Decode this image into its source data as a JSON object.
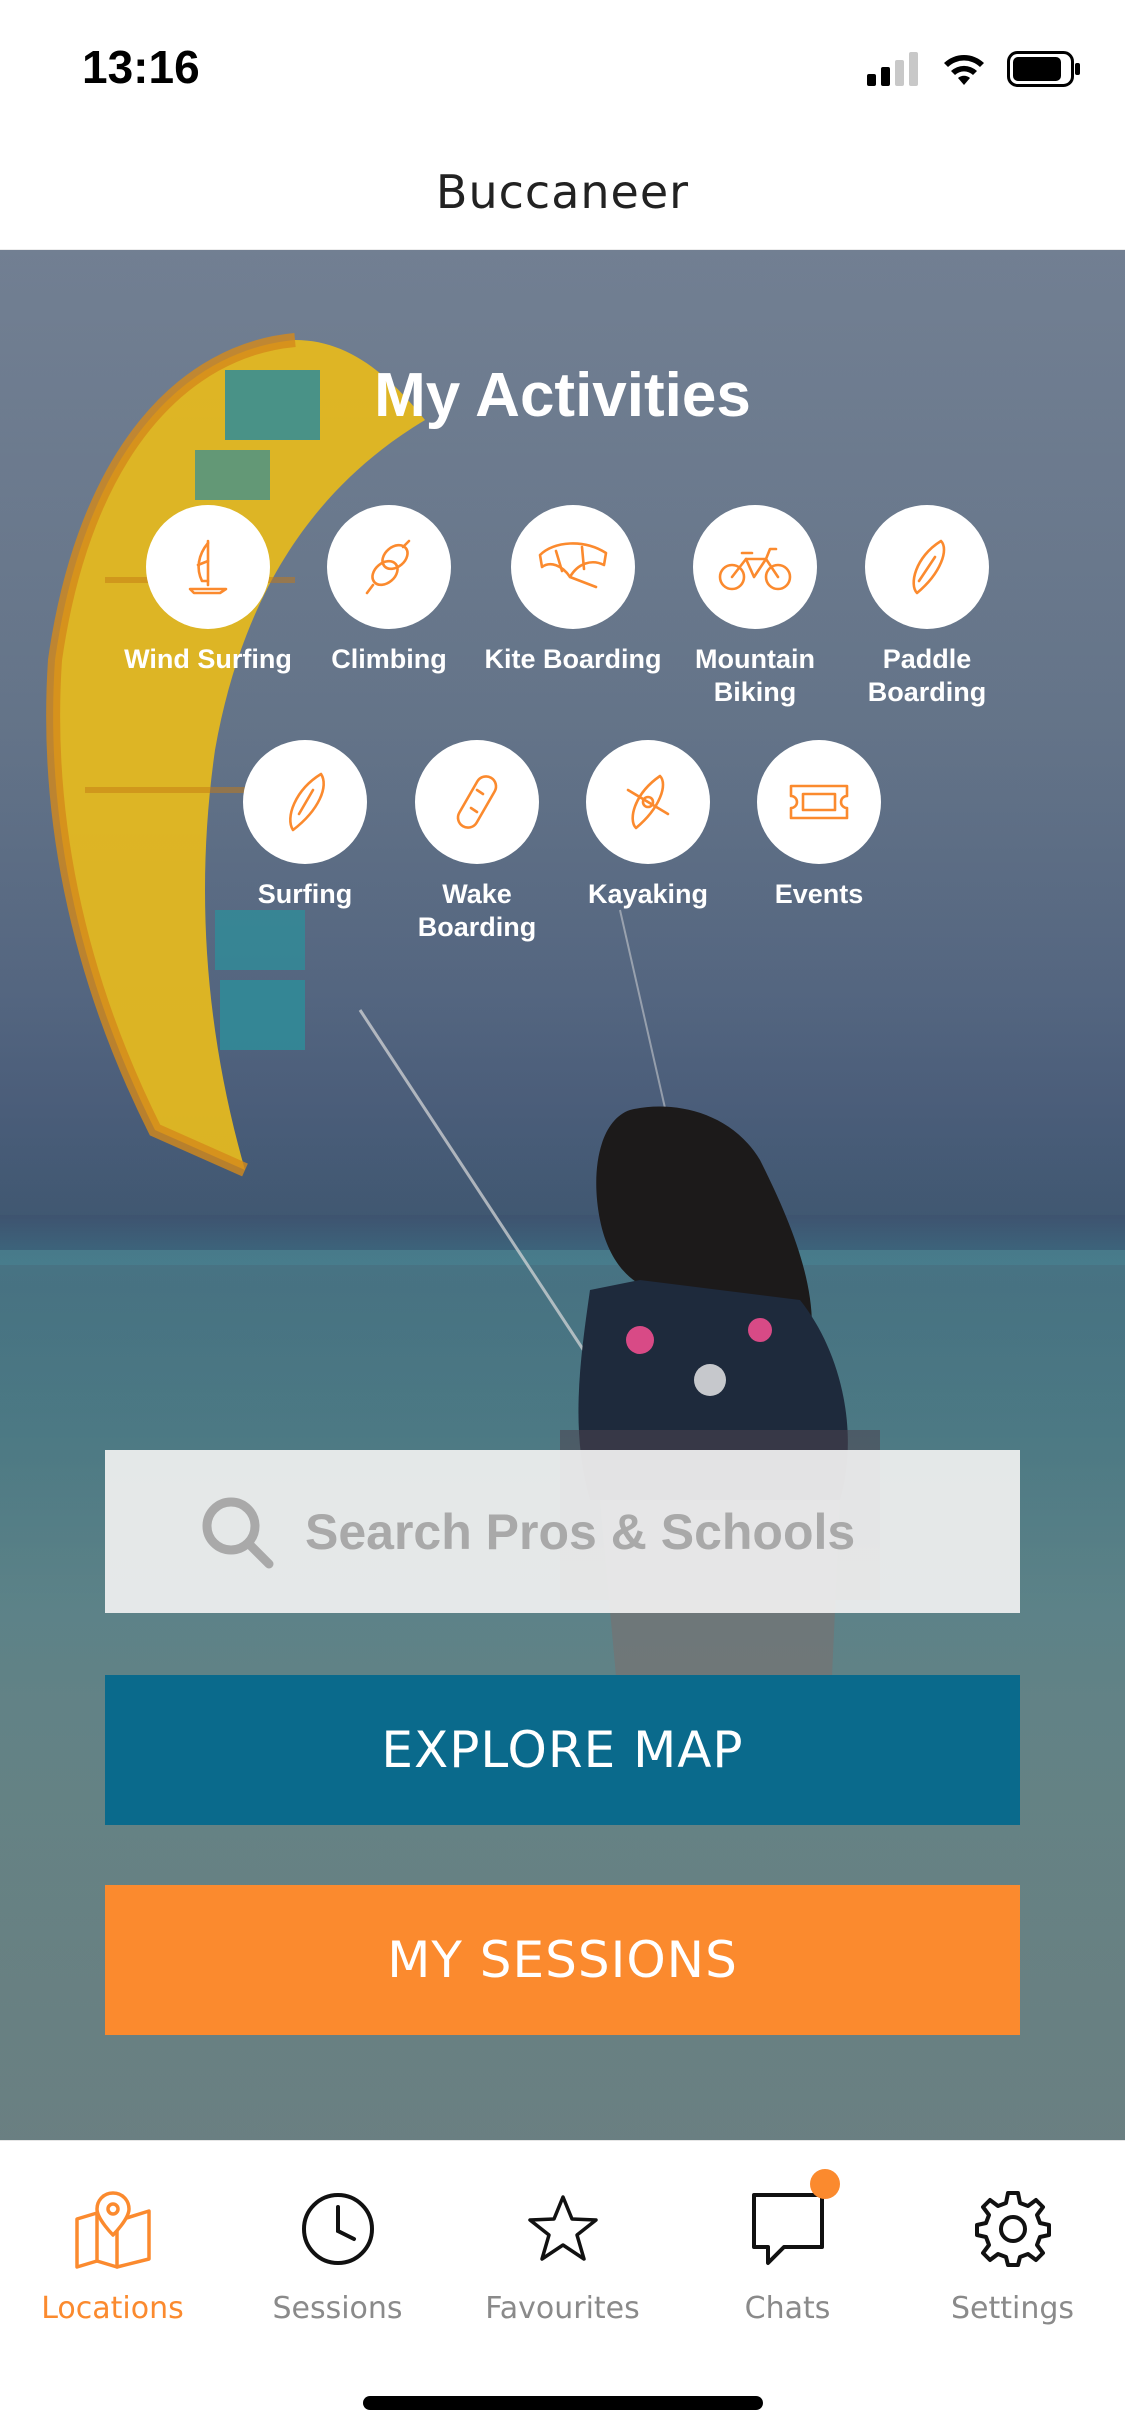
{
  "status_bar": {
    "time": "13:16"
  },
  "nav": {
    "title": "Buccaneer"
  },
  "hero": {
    "title": "My Activities",
    "activities_row1": [
      {
        "label": "Wind Surfing",
        "icon": "windsurf-icon"
      },
      {
        "label": "Climbing",
        "icon": "rope-icon"
      },
      {
        "label": "Kite Boarding",
        "icon": "kite-icon"
      },
      {
        "label": "Mountain Biking",
        "icon": "bike-icon"
      },
      {
        "label": "Paddle Boarding",
        "icon": "paddleboard-icon"
      }
    ],
    "activities_row2": [
      {
        "label": "Surfing",
        "icon": "surfboard-icon"
      },
      {
        "label": "Wake Boarding",
        "icon": "wakeboard-icon"
      },
      {
        "label": "Kayaking",
        "icon": "kayak-icon"
      },
      {
        "label": "Events",
        "icon": "ticket-icon"
      }
    ]
  },
  "search": {
    "placeholder": "Search Pros & Schools"
  },
  "buttons": {
    "explore": "EXPLORE MAP",
    "sessions": "MY SESSIONS"
  },
  "tabs": [
    {
      "label": "Locations",
      "icon": "map-pin-icon",
      "active": true
    },
    {
      "label": "Sessions",
      "icon": "clock-icon",
      "active": false
    },
    {
      "label": "Favourites",
      "icon": "star-icon",
      "active": false
    },
    {
      "label": "Chats",
      "icon": "chat-icon",
      "active": false,
      "badge": true
    },
    {
      "label": "Settings",
      "icon": "gear-icon",
      "active": false
    }
  ],
  "colors": {
    "accent": "#fb8a2e",
    "primary": "#0a6a8c",
    "inactive": "#8a8a8a"
  }
}
